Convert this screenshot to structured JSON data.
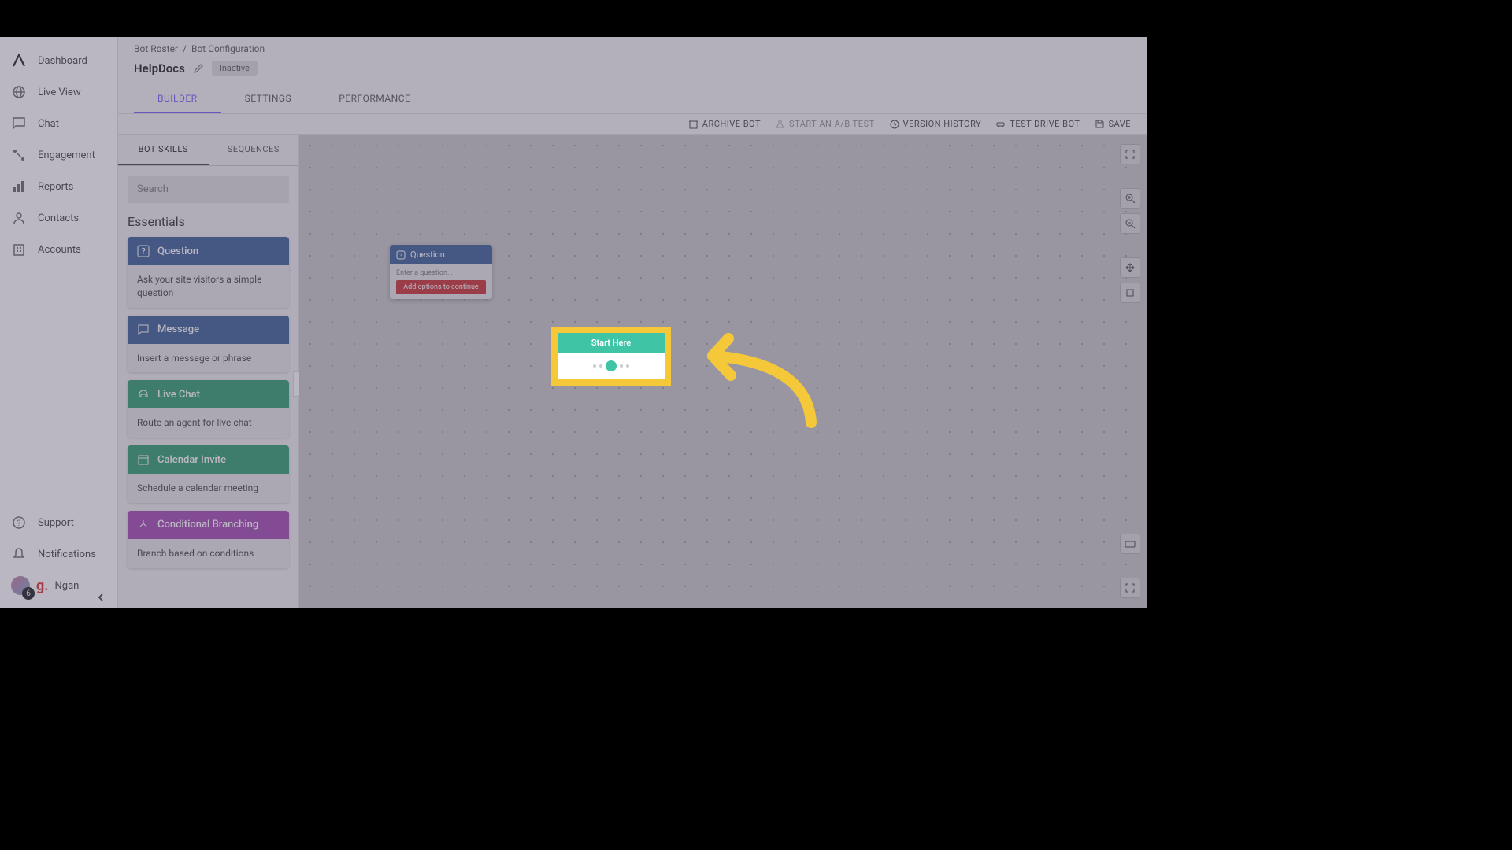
{
  "nav": {
    "items": [
      {
        "label": "Dashboard"
      },
      {
        "label": "Live View"
      },
      {
        "label": "Chat"
      },
      {
        "label": "Engagement"
      },
      {
        "label": "Reports"
      },
      {
        "label": "Contacts"
      },
      {
        "label": "Accounts"
      }
    ],
    "bottom": [
      {
        "label": "Support"
      },
      {
        "label": "Notifications"
      }
    ],
    "user": {
      "name": "Ngan",
      "badge": "6"
    }
  },
  "breadcrumb": {
    "root": "Bot Roster",
    "current": "Bot Configuration"
  },
  "bot": {
    "title": "HelpDocs",
    "status": "Inactive"
  },
  "tabs": [
    {
      "label": "BUILDER",
      "active": true
    },
    {
      "label": "SETTINGS"
    },
    {
      "label": "PERFORMANCE"
    }
  ],
  "actions": [
    {
      "label": "ARCHIVE BOT"
    },
    {
      "label": "START AN A/B TEST",
      "disabled": true
    },
    {
      "label": "VERSION HISTORY"
    },
    {
      "label": "TEST DRIVE BOT"
    },
    {
      "label": "SAVE"
    }
  ],
  "skills": {
    "tabs": [
      {
        "label": "BOT SKILLS",
        "active": true
      },
      {
        "label": "SEQUENCES"
      }
    ],
    "search_placeholder": "Search",
    "section": "Essentials",
    "cards": [
      {
        "title": "Question",
        "desc": "Ask your site visitors a simple question",
        "color": "blue"
      },
      {
        "title": "Message",
        "desc": "Insert a message or phrase",
        "color": "blue"
      },
      {
        "title": "Live Chat",
        "desc": "Route an agent for live chat",
        "color": "green"
      },
      {
        "title": "Calendar Invite",
        "desc": "Schedule a calendar meeting",
        "color": "green"
      },
      {
        "title": "Conditional Branching",
        "desc": "Branch based on conditions",
        "color": "purple"
      }
    ]
  },
  "canvas": {
    "question_node": {
      "title": "Question",
      "placeholder": "Enter a question...",
      "button": "Add options to continue"
    },
    "start_node": {
      "label": "Start Here"
    }
  }
}
